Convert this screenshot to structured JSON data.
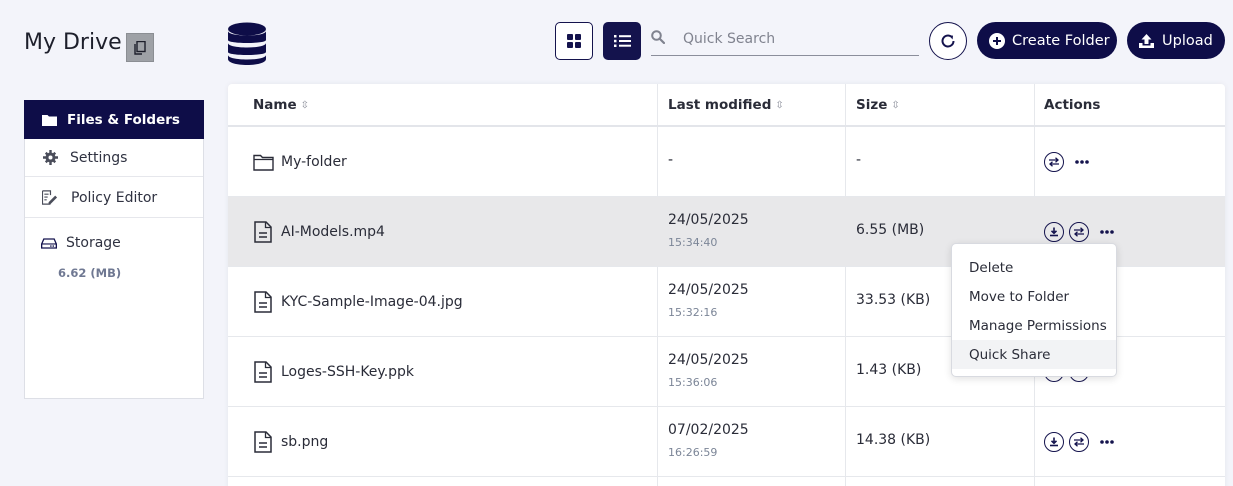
{
  "header": {
    "title": "My Drive",
    "search_placeholder": "Quick Search",
    "create_folder_label": "Create Folder",
    "upload_label": "Upload"
  },
  "sidebar": {
    "items": [
      {
        "label": "Files & Folders",
        "icon": "folder-icon",
        "active": true
      },
      {
        "label": "Settings",
        "icon": "gear-icon"
      },
      {
        "label": "Policy Editor",
        "icon": "edit-document-icon"
      }
    ],
    "storage": {
      "label": "Storage",
      "icon": "drive-icon",
      "value": "6.62 (MB)"
    }
  },
  "table": {
    "columns": [
      "Name",
      "Last modified",
      "Size",
      "Actions"
    ],
    "rows": [
      {
        "name": "My-folder",
        "type": "folder",
        "date": "-",
        "time": "",
        "size": "-"
      },
      {
        "name": "AI-Models.mp4",
        "type": "file",
        "date": "24/05/2025",
        "time": "15:34:40",
        "size": "6.55 (MB)",
        "highlighted": true
      },
      {
        "name": "KYC-Sample-Image-04.jpg",
        "type": "file",
        "date": "24/05/2025",
        "time": "15:32:16",
        "size": "33.53 (KB)"
      },
      {
        "name": "Loges-SSH-Key.ppk",
        "type": "file",
        "date": "24/05/2025",
        "time": "15:36:06",
        "size": "1.43 (KB)"
      },
      {
        "name": "sb.png",
        "type": "file",
        "date": "07/02/2025",
        "time": "16:26:59",
        "size": "14.38 (KB)"
      }
    ]
  },
  "context_menu": {
    "items": [
      "Delete",
      "Move to Folder",
      "Manage Permissions",
      "Quick Share"
    ],
    "hovered": "Quick Share"
  },
  "colors": {
    "primary": "#0e0d48",
    "background": "#f3f4fa",
    "row_highlight": "#e8e8ea",
    "muted_text": "#7b8597"
  }
}
